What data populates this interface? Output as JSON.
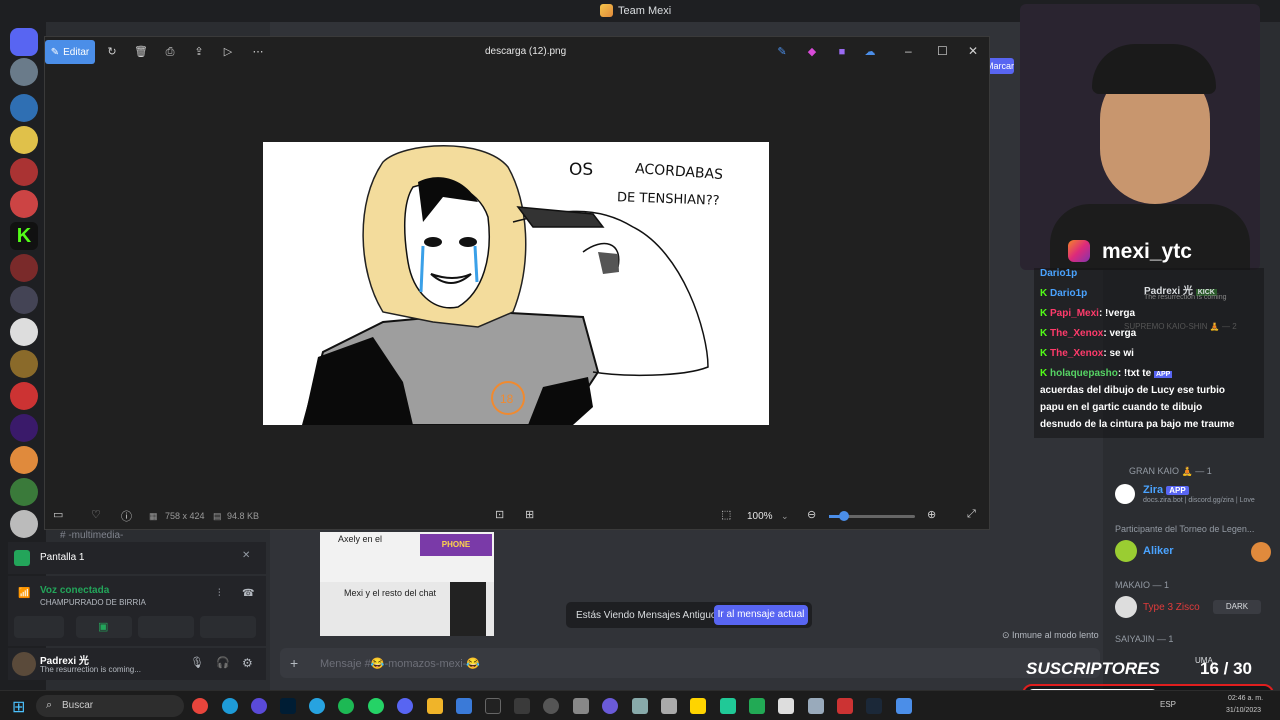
{
  "discord": {
    "title": "Team Mexi",
    "channel_section": "-multimedia-",
    "screen_share": "Pantalla 1",
    "voice_status": "Voz conectada",
    "voice_channel": "CHAMPURRADO DE BIRRIA",
    "user_name": "Padrexi 光",
    "user_status": "The resurrection is coming...",
    "message_placeholder": "Mensaje #😂-momazos-mexi-😂",
    "old_messages_notice": "Estás Viendo Mensajes Antiguos",
    "jump_button": "Ir al mensaje actual",
    "slow_mode": "Inmune al modo lento",
    "marcar": "Marcar",
    "thumb_caption_1": "Axely en el",
    "thumb_caption_2": "Mexi y el resto del chat",
    "thumb_badge": "PHONE"
  },
  "members": {
    "group_gran_kaio": "GRAN KAIO 🧘 — 1",
    "zira_name": "Zira",
    "zira_badge": "APP",
    "zira_sub": "docs.zira.bot | discord.gg/zira | Love",
    "torneo": "Participante del Torneo de Legen...",
    "aliker": "Aliker",
    "makaio": "MAKAIO — 1",
    "type3": "Type 3 Zisco",
    "dark": "DARK",
    "saiyajin": "SAIYAJIN — 1",
    "uma": "UMA"
  },
  "photos": {
    "edit_label": "Editar",
    "file_name": "descarga (12).png",
    "dimensions": "758 x 424",
    "file_size": "94.8 KB",
    "zoom": "100%",
    "drawing_text_1": "OS",
    "drawing_text_2": "ACORDABAS",
    "drawing_text_3": "DE TENSHIAN??"
  },
  "stream": {
    "instagram": "mexi_ytc",
    "subs_label": "SUSCRIPTORES",
    "subs_count": "16 / 30",
    "subs_progress": 0.53
  },
  "chat": [
    {
      "user": "Dario1p",
      "text": "",
      "color": "#4aa3ff"
    },
    {
      "user": "Padrexi 光",
      "text": "The resurrection is coming",
      "color": "#dbdee1",
      "badge": "KICK"
    },
    {
      "user": "Papi_Mexi",
      "text": ": !verga",
      "color": "#ff3b6b"
    },
    {
      "user": "SUPREMO KAIO-SHIN 🧘 — 2",
      "text": "",
      "color": "#8a8a8a"
    },
    {
      "user": "The_Xenox",
      "text": ": verga",
      "color": "#ff3b6b"
    },
    {
      "user": "The_Xenox",
      "text": ": se wi",
      "color": "#ff3b6b"
    },
    {
      "user": "holaquepasho",
      "text": ": !txt te",
      "color": "#56d364",
      "badge": "APP"
    },
    {
      "user": "",
      "text": "acuerdas del dibujo de Lucy ese turbio",
      "color": "#ffffff"
    },
    {
      "user": "",
      "text": "papu en el gartic cuando te dibujo",
      "color": "#ffffff"
    },
    {
      "user": "",
      "text": "desnudo de la cintura pa bajo me traume",
      "color": "#ffffff"
    }
  ],
  "taskbar": {
    "search": "Buscar",
    "lang": "ESP",
    "time": "02:46 a. m.",
    "date": "31/10/2023"
  }
}
